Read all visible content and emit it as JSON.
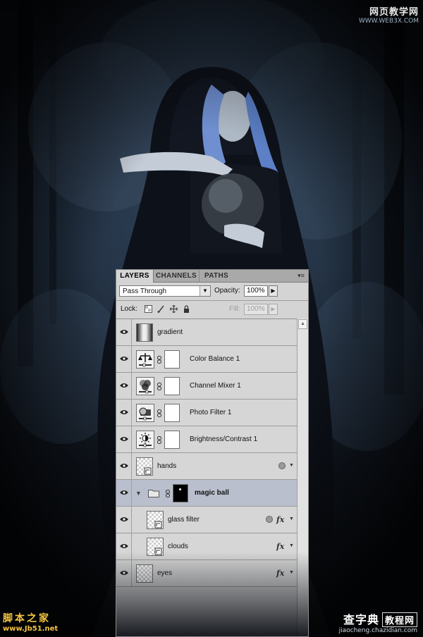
{
  "watermarks": {
    "top_right_title": "网页教学网",
    "top_right_url": "WWW.WEB3X.COM",
    "bottom_left_title": "脚本之家",
    "bottom_left_url": "www.Jb51.net",
    "bottom_right_title": "查字典",
    "bottom_right_box": "教程网",
    "bottom_right_url": "jiaocheng.chazidian.com"
  },
  "panel": {
    "tabs": [
      {
        "label": "LAYERS",
        "active": true
      },
      {
        "label": "CHANNELS",
        "active": false
      },
      {
        "label": "PATHS",
        "active": false
      }
    ],
    "menu_glyph": "▾≡",
    "blend_mode": "Pass Through",
    "opacity_label": "Opacity:",
    "opacity_value": "100%",
    "lock_label": "Lock:",
    "fill_label": "Fill:",
    "fill_value": "100%",
    "layers": [
      {
        "name": "gradient",
        "kind": "pixel-gradient",
        "visible": true
      },
      {
        "name": "Color Balance 1",
        "kind": "adjustment",
        "icon": "scales-icon",
        "visible": true
      },
      {
        "name": "Channel Mixer 1",
        "kind": "adjustment",
        "icon": "channel-mixer-icon",
        "visible": true
      },
      {
        "name": "Photo Filter 1",
        "kind": "adjustment",
        "icon": "photo-filter-icon",
        "visible": true
      },
      {
        "name": "Brightness/Contrast 1",
        "kind": "adjustment",
        "icon": "brightness-icon",
        "visible": true
      },
      {
        "name": "hands",
        "kind": "smart-object",
        "visible": true,
        "blending_options": true
      },
      {
        "name": "magic ball",
        "kind": "group",
        "visible": true,
        "selected": true,
        "expanded": true
      },
      {
        "name": "glass filter",
        "kind": "smart-object",
        "visible": true,
        "indented": true,
        "fx": "fx",
        "blending_options": true
      },
      {
        "name": "clouds",
        "kind": "smart-object",
        "visible": true,
        "indented": true,
        "fx": "fx"
      },
      {
        "name": "eyes",
        "kind": "smart-object",
        "visible": true,
        "fx": "fx"
      }
    ]
  },
  "colors": {
    "panel_bg": "#d4d4d4",
    "selected_row": "#b9bfcc",
    "scene_dark": "#0a0d14",
    "watermark_yellow": "#f4c542"
  }
}
